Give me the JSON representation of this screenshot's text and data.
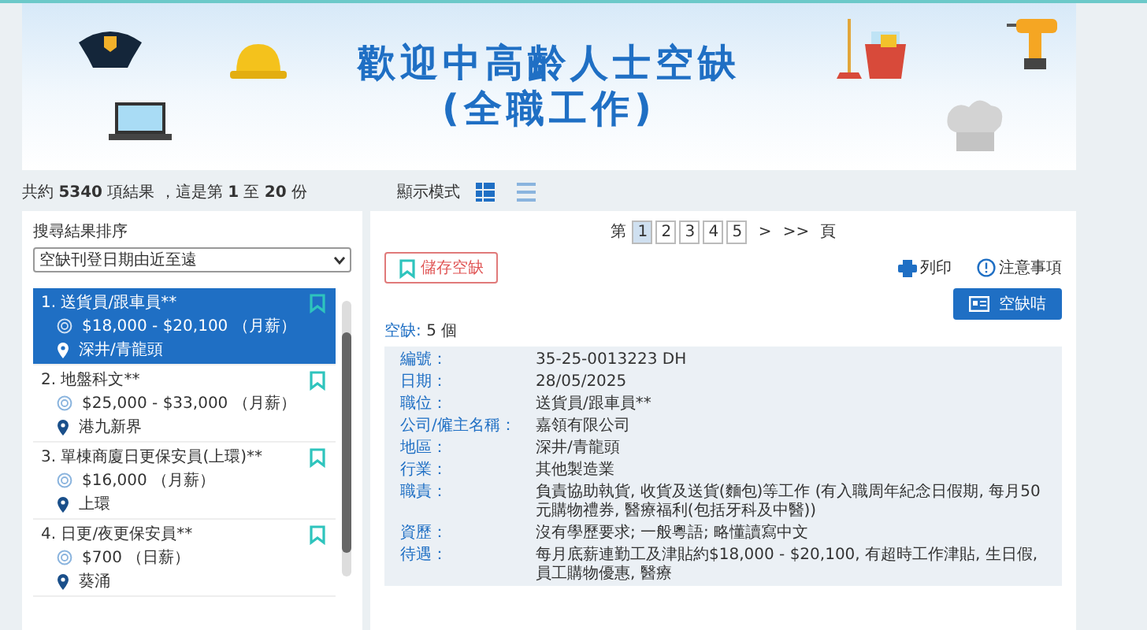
{
  "banner": {
    "title": "歡迎中高齡人士空缺",
    "subtitle": "(全職工作)"
  },
  "results": {
    "summary": "共約 **5340** 項結果 ，這是第 **1** 至 **20** 份",
    "view_label": "顯示模式",
    "view_modes": [
      {
        "kind": "cards",
        "selected": true
      },
      {
        "kind": "lines",
        "selected": false
      }
    ]
  },
  "sort": {
    "label": "搜尋結果排序",
    "value": "空缺刊登日期由近至遠"
  },
  "jobs": [
    {
      "title": "1. 送貨員/跟車員**",
      "salary": "$18,000 - $20,100 （月薪）",
      "location": "深井/青龍頭",
      "selected": true
    },
    {
      "title": "2. 地盤科文**",
      "salary": "$25,000 - $33,000 （月薪）",
      "location": "港九新界",
      "selected": false
    },
    {
      "title": "3. 單棟商廈日更保安員(上環)**",
      "salary": "$16,000 （月薪）",
      "location": "上環",
      "selected": false
    },
    {
      "title": "4. 日更/夜更保安員**",
      "salary": "$700 （日薪）",
      "location": "葵涌",
      "selected": false
    }
  ],
  "pagination": {
    "prefix": "第",
    "pages": [
      {
        "label": "1",
        "selected": true
      },
      {
        "label": "2",
        "selected": false
      },
      {
        "label": "3",
        "selected": false
      },
      {
        "label": "4",
        "selected": false
      },
      {
        "label": "5",
        "selected": false
      }
    ],
    "next": ">",
    "last": ">>",
    "suffix": "頁"
  },
  "actions": {
    "save": "儲存空缺",
    "print": "列印",
    "notice": "注意事項",
    "card": "空缺咭"
  },
  "vacancies": {
    "label": "空缺:",
    "value": "5 個"
  },
  "details": [
    {
      "label": "編號：",
      "value": "35-25-0013223 DH"
    },
    {
      "label": "日期：",
      "value": "28/05/2025"
    },
    {
      "label": "職位：",
      "value": "送貨員/跟車員**"
    },
    {
      "label": "公司/僱主名稱：",
      "value": "嘉領有限公司"
    },
    {
      "label": "地區：",
      "value": "深井/青龍頭"
    },
    {
      "label": "行業：",
      "value": "其他製造業"
    },
    {
      "label": "職責：",
      "value": "負責協助執貨, 收貨及送貨(麵包)等工作 (有入職周年紀念日假期, 每月50元購物禮券, 醫療福利(包括牙科及中醫))"
    },
    {
      "label": "資歷：",
      "value": "沒有學歷要求; 一般粵語; 略懂讀寫中文"
    },
    {
      "label": "待遇：",
      "value": "每月底薪連勤工及津貼約$18,000 - $20,100, 有超時工作津貼, 生日假, 員工購物優惠, 醫療"
    }
  ]
}
